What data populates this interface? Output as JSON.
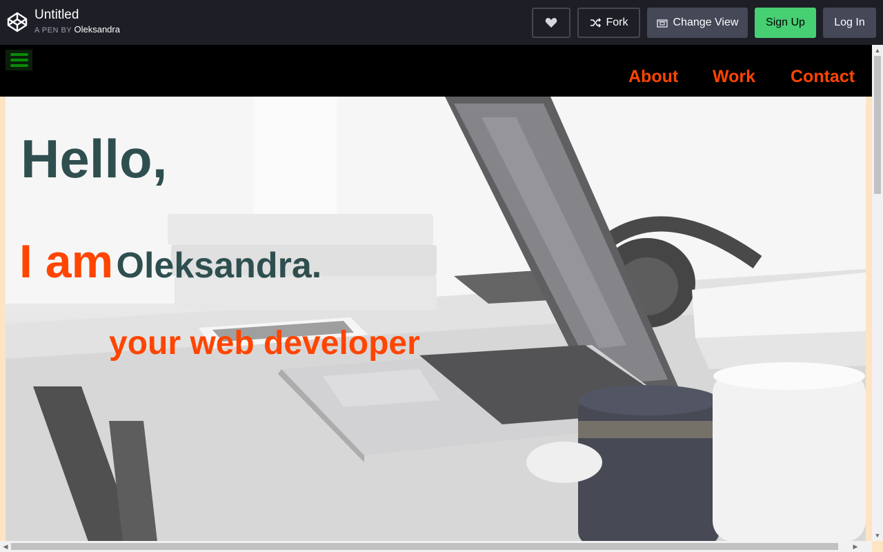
{
  "codepen": {
    "title": "Untitled",
    "byline_prefix": "A PEN BY",
    "author": "Oleksandra",
    "buttons": {
      "fork": "Fork",
      "change_view": "Change View",
      "sign_up": "Sign Up",
      "log_in": "Log In"
    }
  },
  "site": {
    "nav": {
      "items": [
        {
          "label": "About"
        },
        {
          "label": "Work"
        },
        {
          "label": "Contact"
        }
      ]
    },
    "hero": {
      "greeting": "Hello,",
      "iam": "I am",
      "name": "Oleksandra.",
      "tagline": "your web developer"
    }
  },
  "colors": {
    "accent_orange": "#ff4500",
    "slate": "#2f4f4f",
    "signup_green": "#47cf73"
  }
}
